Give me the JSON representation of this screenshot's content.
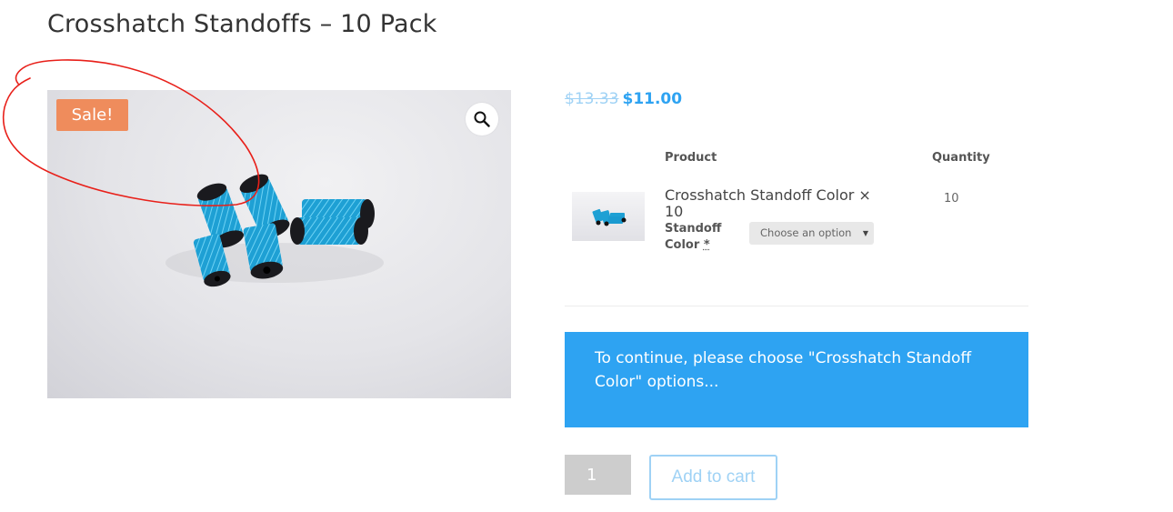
{
  "page": {
    "title": "Crosshatch Standoffs – 10 Pack"
  },
  "gallery": {
    "sale_badge": "Sale!",
    "zoom_icon": "magnifier-icon"
  },
  "price": {
    "old": "$13.33",
    "new": "$11.00"
  },
  "grouped_table": {
    "headers": {
      "product": "Product",
      "quantity": "Quantity"
    },
    "items": [
      {
        "name": "Crosshatch Standoff Color × 10",
        "quantity": "10",
        "attribute_label": "Standoff Color",
        "required_marker": "*",
        "select_value": "Choose an option"
      }
    ]
  },
  "notice": {
    "text": "To continue, please choose \"Crosshatch Standoff Color\" options..."
  },
  "cart": {
    "quantity_value": "1",
    "add_to_cart_label": "Add to cart"
  },
  "colors": {
    "accent": "#2ea3f2",
    "accent_light": "#9fd2f5",
    "sale": "#ef8c5c",
    "annotation": "#e8201a"
  }
}
